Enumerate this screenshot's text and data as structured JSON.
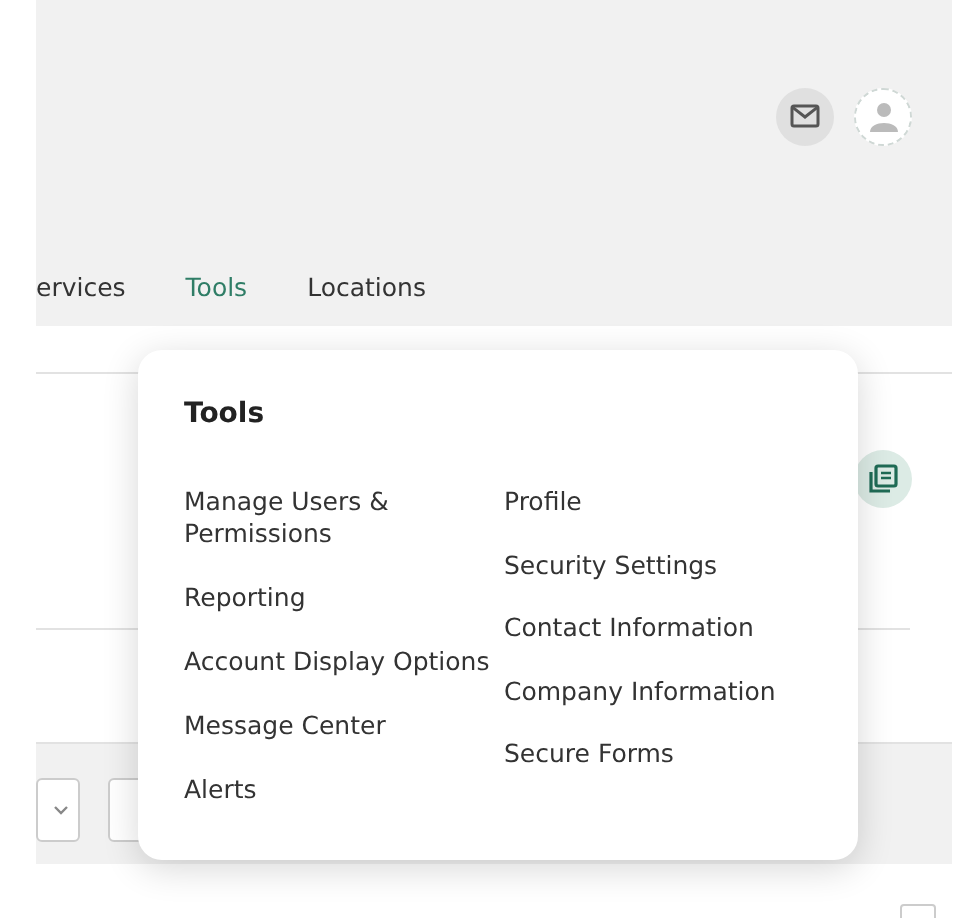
{
  "nav": [
    {
      "label": "ervices",
      "selected": false
    },
    {
      "label": "Tools",
      "selected": true
    },
    {
      "label": "Locations",
      "selected": false
    }
  ],
  "checkbox": {
    "checked": false
  },
  "menu": {
    "title": "Tools",
    "columns": [
      [
        "Manage Users & Permissions",
        "Reporting",
        "Account Display Options",
        "Message Center",
        "Alerts"
      ],
      [
        "Profile",
        "Security Settings",
        "Contact Information",
        "Company Information",
        "Secure Forms"
      ]
    ]
  }
}
